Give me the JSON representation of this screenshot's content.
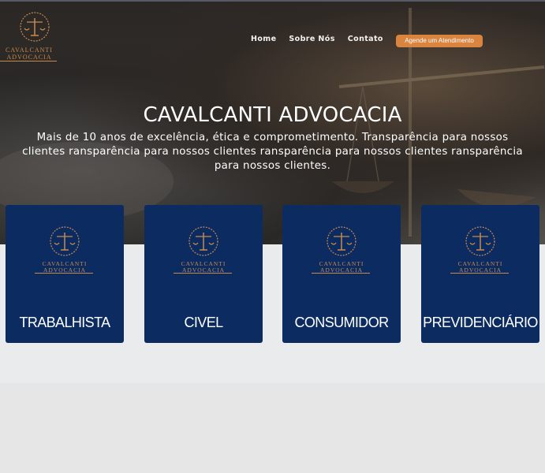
{
  "brand": {
    "line1": "CAVALCANTI",
    "line2": "ADVOCACIA"
  },
  "nav": {
    "home": "Home",
    "about": "Sobre Nós",
    "contact": "Contato",
    "cta": "Agende um Atendimento"
  },
  "hero": {
    "title": "CAVALCANTI ADVOCACIA",
    "subtitle": "Mais de 10 anos de excelência, ética e comprometimento. Transparência para nossos clientes ransparência para nossos clientes ransparência para nossos clientes ransparência para nossos clientes."
  },
  "areas": [
    {
      "label": "TRABALHISTA",
      "emblem_line1": "CAVALCANTI",
      "emblem_line2": "ADVOCACIA"
    },
    {
      "label": "CIVEL",
      "emblem_line1": "CAVALCANTI",
      "emblem_line2": "ADVOCACIA"
    },
    {
      "label": "CONSUMIDOR",
      "emblem_line1": "CAVALCANTI",
      "emblem_line2": "ADVOCACIA"
    },
    {
      "label": "PREVIDENCIÁRIO",
      "emblem_line1": "CAVALCANTI",
      "emblem_line2": "ADVOCACIA"
    }
  ],
  "colors": {
    "accent": "#d9843f",
    "gold": "#c98a4e",
    "card": "#0c2b60"
  }
}
